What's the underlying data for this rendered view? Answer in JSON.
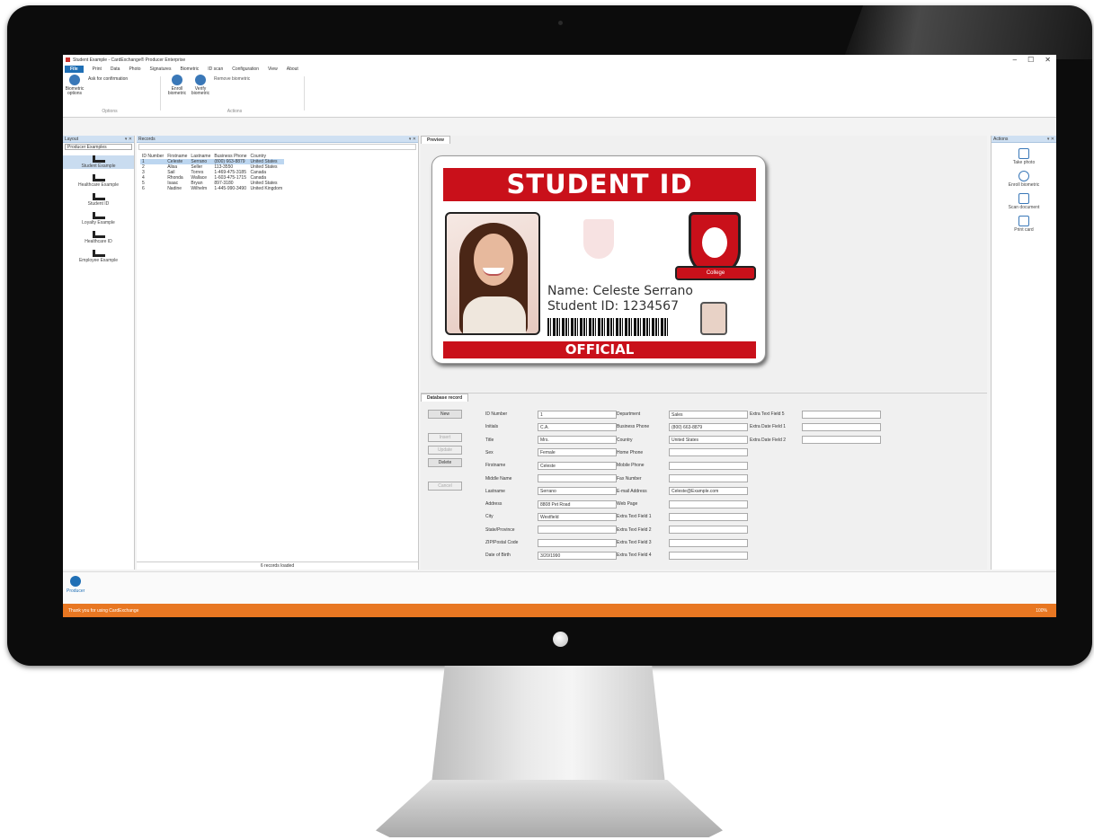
{
  "window": {
    "title": "Student Example - CardExchange® Producer Enterprise"
  },
  "menu": {
    "file": "File",
    "items": [
      "Print",
      "Data",
      "Photo",
      "Signatures",
      "Biometric",
      "ID scan",
      "Configuration",
      "View",
      "About"
    ]
  },
  "ribbon": {
    "biometric_options": "Biometric options",
    "ask_confirmation": "Ask for confirmation",
    "options_group": "Options",
    "enroll": "Enroll biometric",
    "verify": "Verify biometric",
    "remove": "Remove biometric",
    "actions_group": "Actions"
  },
  "layouts": {
    "header": "Layout",
    "dropdown": "Producer Examples",
    "items": [
      "Student Example",
      "Healthcare Example",
      "Student ID",
      "Loyalty Example",
      "Healthcare ID",
      "Employee Example"
    ]
  },
  "records": {
    "header": "Records",
    "columns": [
      "ID Number",
      "Firstname",
      "Lastname",
      "Business Phone",
      "Country"
    ],
    "rows": [
      [
        "1",
        "Celeste",
        "Serrano",
        "(800) 663-8879",
        "United States"
      ],
      [
        "2",
        "Alisa",
        "Seller",
        "113-3550",
        "United States"
      ],
      [
        "3",
        "Sail",
        "Torres",
        "1-469-475-3185",
        "Canada"
      ],
      [
        "4",
        "Rhonda",
        "Wallace",
        "1-603-475-1715",
        "Canada"
      ],
      [
        "5",
        "Isaac",
        "Bryan",
        "897-3180",
        "United States"
      ],
      [
        "6",
        "Nadine",
        "Wilhelm",
        "1-445-990-3490",
        "United Kingdom"
      ]
    ],
    "status": "6 records loaded"
  },
  "preview": {
    "tab": "Preview",
    "card": {
      "header": "STUDENT ID",
      "name_line": "Name: Celeste Serrano",
      "id_line": "Student ID: 1234567",
      "footer": "OFFICIAL",
      "crest_label": "College"
    }
  },
  "database_record": {
    "tab": "Database record",
    "buttons": {
      "new": "New",
      "insert": "Insert",
      "update": "Update",
      "delete": "Delete",
      "cancel": "Cancel"
    },
    "col1": [
      {
        "label": "ID Number",
        "value": "1"
      },
      {
        "label": "Initials",
        "value": "C.A."
      },
      {
        "label": "Title",
        "value": "Mrs."
      },
      {
        "label": "Sex",
        "value": "Female"
      },
      {
        "label": "Firstname",
        "value": "Celeste"
      },
      {
        "label": "Middle Name",
        "value": ""
      },
      {
        "label": "Lastname",
        "value": "Serrano"
      },
      {
        "label": "Address",
        "value": "8808 Pet Road"
      },
      {
        "label": "City",
        "value": "Westfield"
      },
      {
        "label": "State/Province",
        "value": ""
      },
      {
        "label": "ZIP/Postal Code",
        "value": ""
      },
      {
        "label": "Date of Birth",
        "value": "3/20/1990"
      }
    ],
    "col2": [
      {
        "label": "Department",
        "value": "Sales"
      },
      {
        "label": "Business Phone",
        "value": "(800) 663-8879"
      },
      {
        "label": "Country",
        "value": "United States"
      },
      {
        "label": "Home Phone",
        "value": ""
      },
      {
        "label": "Mobile Phone",
        "value": ""
      },
      {
        "label": "Fax Number",
        "value": ""
      },
      {
        "label": "E-mail Address",
        "value": "Celeste@Example.com"
      },
      {
        "label": "Web Page",
        "value": ""
      },
      {
        "label": "Extra Text Field 1",
        "value": ""
      },
      {
        "label": "Extra Text Field 2",
        "value": ""
      },
      {
        "label": "Extra Text Field 3",
        "value": ""
      },
      {
        "label": "Extra Text Field 4",
        "value": ""
      }
    ],
    "col3": [
      {
        "label": "Extra Text Field 5",
        "value": ""
      },
      {
        "label": "Extra Date Field 1",
        "value": ""
      },
      {
        "label": "Extra Date Field 2",
        "value": ""
      }
    ]
  },
  "actions_panel": {
    "header": "Actions",
    "items": [
      "Take photo",
      "Enroll biometric",
      "Scan document",
      "Print card"
    ]
  },
  "bottom": {
    "producer": "Producer"
  },
  "status": {
    "left": "Thank you for using CardExchange",
    "zoom": "100%"
  },
  "colors": {
    "accent": "#c9101a",
    "status": "#e87722",
    "ribbon_blue": "#1f6fb5"
  }
}
